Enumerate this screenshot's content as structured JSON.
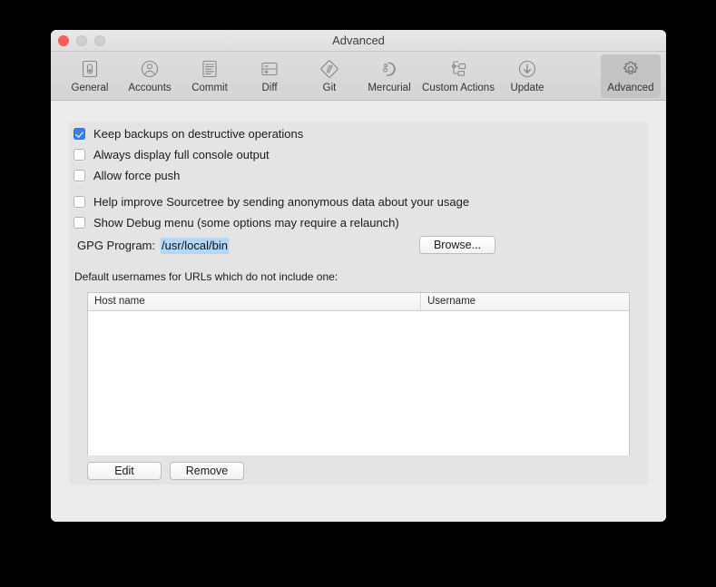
{
  "window": {
    "title": "Advanced",
    "traffic_lights": [
      {
        "name": "close",
        "color": "#ff6159"
      },
      {
        "name": "minimize",
        "color": "#cfcfcf"
      },
      {
        "name": "zoom",
        "color": "#cfcfcf"
      }
    ]
  },
  "toolbar": {
    "items": [
      {
        "label": "General",
        "icon": "general-icon",
        "selected": false
      },
      {
        "label": "Accounts",
        "icon": "accounts-icon",
        "selected": false
      },
      {
        "label": "Commit",
        "icon": "commit-icon",
        "selected": false
      },
      {
        "label": "Diff",
        "icon": "diff-icon",
        "selected": false
      },
      {
        "label": "Git",
        "icon": "git-icon",
        "selected": false
      },
      {
        "label": "Mercurial",
        "icon": "mercurial-icon",
        "selected": false
      },
      {
        "label": "Custom Actions",
        "icon": "custom-actions-icon",
        "selected": false
      },
      {
        "label": "Update",
        "icon": "update-icon",
        "selected": false
      },
      {
        "label": "Advanced",
        "icon": "gear-icon",
        "selected": true
      }
    ]
  },
  "checkboxes": [
    {
      "label": "Keep backups on destructive operations",
      "checked": true
    },
    {
      "label": "Always display full console output",
      "checked": false
    },
    {
      "label": "Allow force push",
      "checked": false
    },
    {
      "label": "Help improve Sourcetree by sending anonymous data about your usage",
      "checked": false
    },
    {
      "label": "Show Debug menu (some options may require a relaunch)",
      "checked": false
    }
  ],
  "gpg": {
    "label": "GPG Program:",
    "value": "/usr/local/bin",
    "value_selected": true,
    "browse_label": "Browse..."
  },
  "usernames_section": {
    "caption": "Default usernames for URLs which do not include one:",
    "columns": [
      "Host name",
      "Username"
    ],
    "rows": [],
    "edit_label": "Edit",
    "remove_label": "Remove"
  },
  "colors": {
    "accent_checkbox": "#3b7ef3",
    "text_selection": "#b3d7f8",
    "window_background": "#ececec",
    "panel_background": "#e4e4e4",
    "toolbar_selected": "#c4c4c4"
  }
}
